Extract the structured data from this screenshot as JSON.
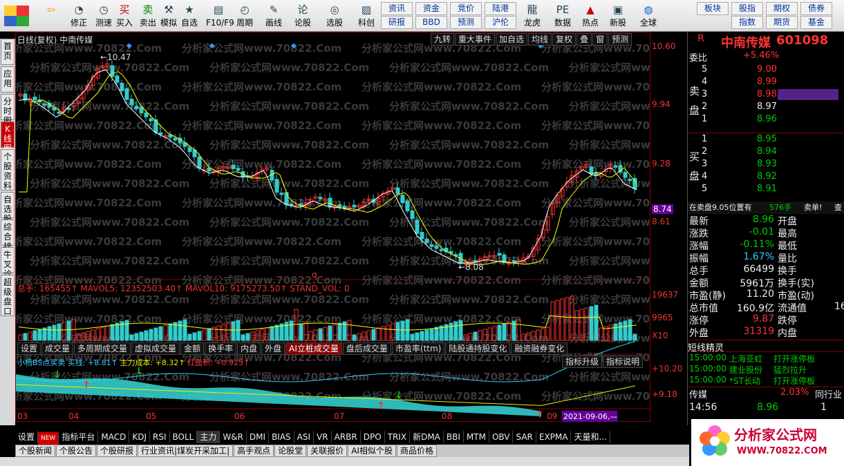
{
  "toolbar": {
    "buttons": [
      {
        "id": "back",
        "label": "",
        "icon": "back-arrow-icon"
      },
      {
        "id": "fix",
        "label": "修正",
        "icon": "refresh-icon"
      },
      {
        "id": "test",
        "label": "测速",
        "icon": "clock-icon"
      },
      {
        "id": "buy",
        "label": "买入",
        "icon": "buy-icon"
      },
      {
        "id": "sell",
        "label": "卖出",
        "icon": "sell-icon"
      },
      {
        "id": "sim",
        "label": "模拟",
        "icon": "hammer-icon"
      },
      {
        "id": "fav",
        "label": "自选",
        "icon": "star-icon"
      },
      {
        "id": "f10",
        "label": "F10/F9",
        "icon": "f10-icon"
      },
      {
        "id": "period",
        "label": "周期",
        "icon": "period-icon"
      },
      {
        "id": "draw",
        "label": "画线",
        "icon": "pencil-icon"
      },
      {
        "id": "lunzheng",
        "label": "论股",
        "icon": "lunzheng-icon"
      },
      {
        "id": "select",
        "label": "选股",
        "icon": "selector-icon"
      },
      {
        "id": "kechuang",
        "label": "科创",
        "icon": "kechuang-icon"
      },
      {
        "id": "longhu",
        "label": "龙虎",
        "icon": "dragon-icon"
      },
      {
        "id": "data",
        "label": "数据",
        "icon": "pe-icon"
      },
      {
        "id": "hot",
        "label": "热点",
        "icon": "hot-icon"
      },
      {
        "id": "newstock",
        "label": "新股",
        "icon": "ipo-icon"
      },
      {
        "id": "global",
        "label": "全球",
        "icon": "globe-icon"
      }
    ],
    "textbtns": [
      "资讯",
      "资金",
      "竞价",
      "陆港",
      "研报",
      "BBD",
      "预测",
      "沪伦",
      "板块",
      "股指",
      "期权",
      "债券",
      "指数",
      "期货",
      "基金"
    ]
  },
  "lefttabs": [
    "首页",
    "应用",
    "分时图",
    "K线图",
    "个股资料",
    "自选股",
    "综合排名",
    "牛叉诊股",
    "超级盘口"
  ],
  "chart": {
    "title_period": "日线(复权)",
    "title_name": "中南传媒",
    "top_buttons": [
      "九转",
      "重大事件",
      "加自选",
      "均线",
      "复权",
      "叠",
      "窗",
      "预测"
    ],
    "high_label": "10.47",
    "low_label": "8.08",
    "q_label": "q",
    "vol_title": "总手: 165455↑  MAVOL5: 12352503.40↑  MAVOL10: 9175273.50↑  STAND_VOL: 0",
    "tabs": [
      "设置",
      "成交量",
      "多周期成交量",
      "虚拟成交量",
      "金额",
      "换手率",
      "内盘",
      "外盘",
      "AI立桩成交量",
      "盘后成交量",
      "市盈率(ttm)",
      "陆股通持股变化",
      "融资融券变化"
    ],
    "ind_title_a": "小杨BS点买卖",
    "ind_title_b": "买线: +8.81↑",
    "ind_title_c": "主力成本: +8.32↑",
    "ind_title_d": "红面积: +0.925↑",
    "ind_btn1": "指标升级",
    "ind_btn2": "指标说明",
    "months": [
      "03",
      "04",
      "05",
      "06",
      "07",
      "08",
      "09"
    ],
    "date_tag": "2021-09-06,—"
  },
  "chart_data": {
    "type": "candlestick",
    "price_scale": [
      "10.60",
      "9.94",
      "9.28",
      "8.74",
      "8.61"
    ],
    "vol_scale": [
      "19637",
      "9965",
      "X10"
    ],
    "ind_scale": [
      "+10.20",
      "+9.18"
    ],
    "high": 10.47,
    "low": 8.08,
    "last": 8.74
  },
  "panel": {
    "code_r": "R",
    "name": "中南传媒",
    "code": "601098",
    "wb_label": "委比",
    "wb_val": "+5.46%",
    "sell": [
      [
        "5",
        "9.00",
        ""
      ],
      [
        "4",
        "8.99",
        ""
      ],
      [
        "3",
        "8.98",
        ""
      ],
      [
        "2",
        "8.97",
        ""
      ],
      [
        "1",
        "8.96",
        ""
      ]
    ],
    "buy": [
      [
        "1",
        "8.95",
        ""
      ],
      [
        "2",
        "8.94",
        ""
      ],
      [
        "3",
        "8.93",
        ""
      ],
      [
        "4",
        "8.92",
        ""
      ],
      [
        "5",
        "8.91",
        ""
      ]
    ],
    "sell_label": "卖盘",
    "buy_label": "买盘",
    "notice": "在卖盘9.05位置有",
    "notice_v": "576手",
    "notice_t": "卖单!",
    "notice_x": "查",
    "stats": [
      [
        "最新",
        "8.96",
        "开盘",
        ""
      ],
      [
        "涨跌",
        "-0.01",
        "最高",
        ""
      ],
      [
        "涨幅",
        "-0.11%",
        "最低",
        ""
      ],
      [
        "振幅",
        "1.67%",
        "量比",
        ""
      ],
      [
        "总手",
        "66499",
        "换手",
        ""
      ],
      [
        "金额",
        "5961万",
        "换手(实)",
        ""
      ],
      [
        "市盈(静)",
        "11.20",
        "市盈(动)",
        ""
      ],
      [
        "总市值",
        "160.9亿",
        "流通值",
        "16"
      ],
      [
        "涨停",
        "9.87",
        "跌停",
        ""
      ],
      [
        "外盘",
        "31319",
        "内盘",
        ""
      ]
    ],
    "sprite_title": "短线精灵",
    "sprites": [
      [
        "15:00:00",
        "上海亚虹",
        "打开涨停板"
      ],
      [
        "15:00:00",
        "建业股份",
        "猛烈拉升"
      ],
      [
        "15:00:00",
        "*ST长动",
        "打开涨停板"
      ]
    ],
    "sector": "传媒",
    "sector_pct": "2.03%",
    "sector_tab": "同行业",
    "tick_time": "14:56",
    "tick_price": "8.96",
    "tick_vol": "1"
  },
  "bottom": {
    "indicators": [
      "设置",
      "NEW",
      "指标平台",
      "MACD",
      "KDJ",
      "RSI",
      "BOLL",
      "主力",
      "W&R",
      "DMI",
      "BIAS",
      "ASI",
      "VR",
      "ARBR",
      "DPO",
      "TRIX",
      "新DMA",
      "BBI",
      "MTM",
      "OBV",
      "SAR",
      "EXPMA",
      "天量和..."
    ],
    "news": [
      "个股新闻",
      "个股公告",
      "个股研报",
      "行业资讯|煤炭开采加工|",
      "高手观点",
      "论股堂",
      "关联报价",
      "AI相似个股",
      "商品价格"
    ]
  },
  "logo": {
    "text": "分析家公式网",
    "url": "WWW.70822.COM"
  },
  "watermark": "分析家公式网www.70822.Com",
  "colors": {
    "up": "#ff3333",
    "down": "#33cccc",
    "ma5": "#ffffff",
    "ma10": "#ffff00",
    "accent": "#cc0000"
  }
}
